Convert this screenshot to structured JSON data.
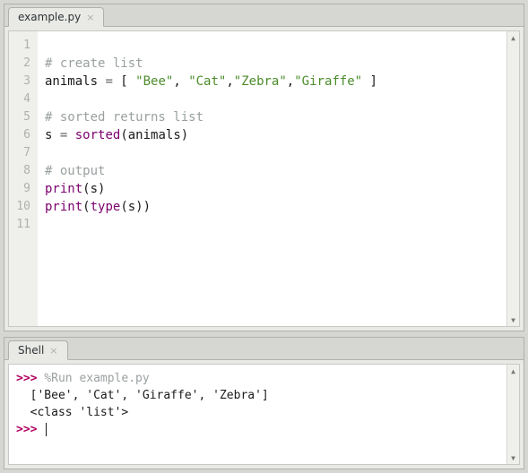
{
  "editor": {
    "tab_label": "example.py",
    "lines": [
      {
        "n": "1",
        "tokens": []
      },
      {
        "n": "2",
        "tokens": [
          {
            "t": "# create list",
            "c": "tk-comment"
          }
        ]
      },
      {
        "n": "3",
        "tokens": [
          {
            "t": "animals ",
            "c": "tk-name"
          },
          {
            "t": "=",
            "c": "tk-op"
          },
          {
            "t": " [ ",
            "c": "tk-name"
          },
          {
            "t": "\"Bee\"",
            "c": "tk-string"
          },
          {
            "t": ", ",
            "c": "tk-name"
          },
          {
            "t": "\"Cat\"",
            "c": "tk-string"
          },
          {
            "t": ",",
            "c": "tk-name"
          },
          {
            "t": "\"Zebra\"",
            "c": "tk-string"
          },
          {
            "t": ",",
            "c": "tk-name"
          },
          {
            "t": "\"Giraffe\"",
            "c": "tk-string"
          },
          {
            "t": " ]",
            "c": "tk-name"
          }
        ]
      },
      {
        "n": "4",
        "tokens": []
      },
      {
        "n": "5",
        "tokens": [
          {
            "t": "# sorted returns list",
            "c": "tk-comment"
          }
        ]
      },
      {
        "n": "6",
        "tokens": [
          {
            "t": "s ",
            "c": "tk-name"
          },
          {
            "t": "=",
            "c": "tk-op"
          },
          {
            "t": " ",
            "c": "tk-name"
          },
          {
            "t": "sorted",
            "c": "tk-builtin"
          },
          {
            "t": "(animals)",
            "c": "tk-name"
          }
        ]
      },
      {
        "n": "7",
        "tokens": []
      },
      {
        "n": "8",
        "tokens": [
          {
            "t": "# output",
            "c": "tk-comment"
          }
        ]
      },
      {
        "n": "9",
        "tokens": [
          {
            "t": "print",
            "c": "tk-builtin"
          },
          {
            "t": "(s)",
            "c": "tk-name"
          }
        ]
      },
      {
        "n": "10",
        "tokens": [
          {
            "t": "print",
            "c": "tk-builtin"
          },
          {
            "t": "(",
            "c": "tk-name"
          },
          {
            "t": "type",
            "c": "tk-builtin"
          },
          {
            "t": "(s))",
            "c": "tk-name"
          }
        ]
      },
      {
        "n": "11",
        "tokens": []
      }
    ]
  },
  "shell": {
    "tab_label": "Shell",
    "prompt": ">>>",
    "run_command": "%Run example.py",
    "output_lines": [
      "['Bee', 'Cat', 'Giraffe', 'Zebra']",
      "<class 'list'>"
    ]
  }
}
